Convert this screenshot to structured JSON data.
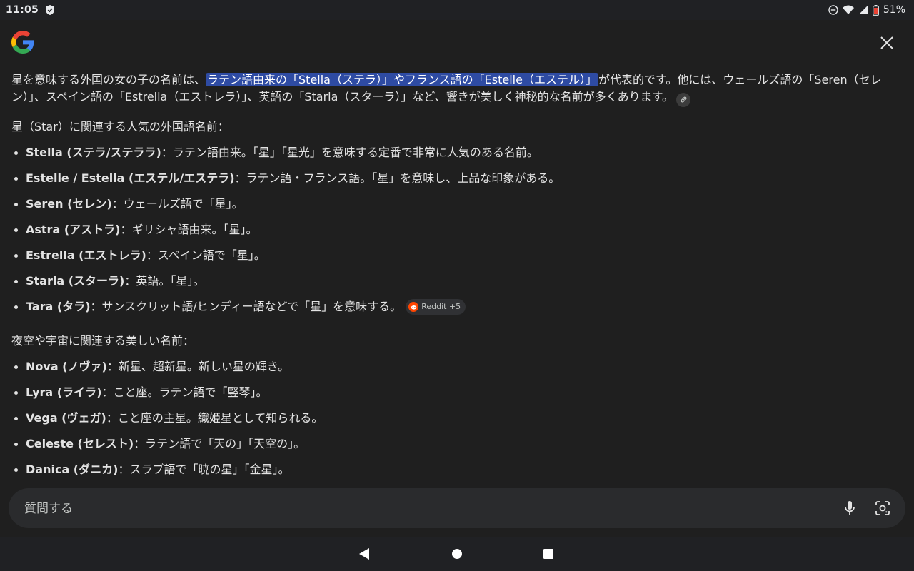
{
  "status_bar": {
    "time": "11:05",
    "battery": "51%"
  },
  "answer": {
    "intro_pre": "星を意味する外国の女の子の名前は、",
    "intro_highlight": "ラテン語由来の「Stella（ステラ）」やフランス語の「Estelle（エステル）」",
    "intro_post": "が代表的です。他には、ウェールズ語の「Seren（セレン）」、スペイン語の「Estrella（エストレラ）」、英語の「Starla（スターラ）」など、響きが美しく神秘的な名前が多くあります。",
    "section1_title": "星（Star）に関連する人気の外国語名前：",
    "section1_items": [
      {
        "term": "Stella (ステラ/ステララ)",
        "desc": "：ラテン語由来。「星」「星光」を意味する定番で非常に人気のある名前。"
      },
      {
        "term": "Estelle / Estella (エステル/エステラ)",
        "desc": "：ラテン語・フランス語。「星」を意味し、上品な印象がある。"
      },
      {
        "term": "Seren (セレン)",
        "desc": "：ウェールズ語で「星」。"
      },
      {
        "term": "Astra (アストラ)",
        "desc": "：ギリシャ語由来。「星」。"
      },
      {
        "term": "Estrella (エストレラ)",
        "desc": "：スペイン語で「星」。"
      },
      {
        "term": "Starla (スターラ)",
        "desc": "：英語。「星」。"
      },
      {
        "term": "Tara (タラ)",
        "desc": "：サンスクリット語/ヒンディー語などで「星」を意味する。"
      }
    ],
    "source_chip": "Reddit +5",
    "section2_title": "夜空や宇宙に関連する美しい名前：",
    "section2_items": [
      {
        "term": "Nova (ノヴァ)",
        "desc": "：新星、超新星。新しい星の輝き。"
      },
      {
        "term": "Lyra (ライラ)",
        "desc": "：こと座。ラテン語で「竪琴」。"
      },
      {
        "term": "Vega (ヴェガ)",
        "desc": "：こと座の主星。織姫星として知られる。"
      },
      {
        "term": "Celeste (セレスト)",
        "desc": "：ラテン語で「天の」「天空の」。"
      },
      {
        "term": "Danica (ダニカ)",
        "desc": "：スラブ語で「暁の星」「金星」。"
      }
    ]
  },
  "ask_bar": {
    "placeholder": "質問する"
  },
  "colors": {
    "background": "#1f1f1f",
    "highlight": "#2e4ba3",
    "reddit": "#ff4500"
  }
}
